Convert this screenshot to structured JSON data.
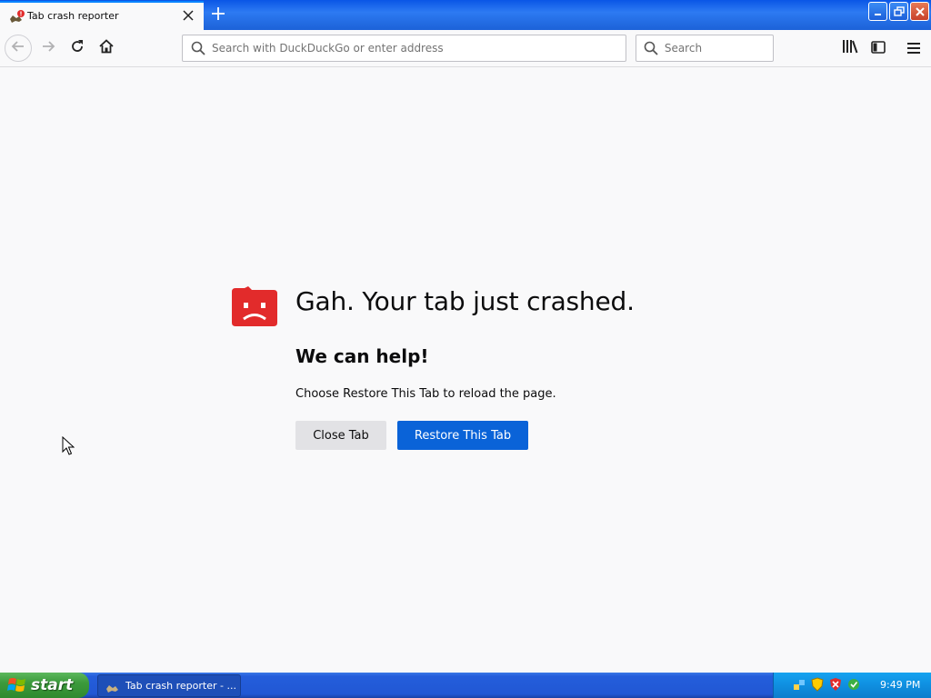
{
  "browser": {
    "tab": {
      "title": "Tab crash reporter",
      "close_icon": "close-icon"
    },
    "new_tab_icon": "plus-icon",
    "window_controls": [
      "minimize",
      "maximize",
      "close"
    ]
  },
  "toolbar": {
    "url_placeholder": "Search with DuckDuckGo or enter address",
    "search_placeholder": "Search"
  },
  "crash_page": {
    "title": "Gah. Your tab just crashed.",
    "subtitle": "We can help!",
    "message": "Choose Restore This Tab to reload the page.",
    "close_button": "Close Tab",
    "restore_button": "Restore This Tab"
  },
  "taskbar": {
    "start_label": "start",
    "task_item_label": "Tab crash reporter - ...",
    "clock": "9:49 PM"
  },
  "colors": {
    "accent": "#0a63d8",
    "crash_icon": "#e22b2b",
    "titlebar": "#1c62d8",
    "taskbar": "#245edb"
  }
}
